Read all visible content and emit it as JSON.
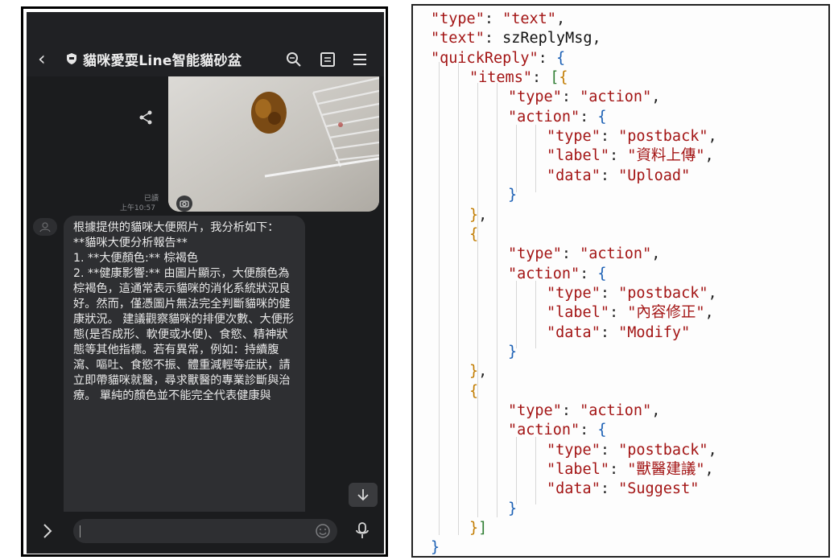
{
  "chat": {
    "title": "貓咪愛耍Line智能貓砂盆",
    "read_label": "已讀",
    "time": "上午10:57",
    "bot_message": [
      "根據提供的貓咪大便照片，我分析如下：",
      "",
      "**貓咪大便分析報告**",
      "",
      "1. **大便顏色:** 棕褐色",
      "",
      "2. **健康影響:** 由圖片顯示，大便顏色為棕褐色，這通常表示貓咪的消化系統狀況良好。然而，僅憑圖片無法完全判斷貓咪的健康狀況。 建議觀察貓咪的排便次數、大便形態(是否成形、軟便或水便)、食慾、精神狀態等其他指標。若有異常，例如：持續腹瀉、嘔吐、食慾不振、體重減輕等症狀，請立即帶貓咪就醫，尋求獸醫的專業診斷與治療。 單純的顏色並不能完全代表健康與"
    ],
    "input_placeholder": "",
    "icons": [
      "back-icon",
      "shield-icon",
      "search-icon",
      "notes-icon",
      "menu-icon",
      "share-icon",
      "camera-icon",
      "scroll-down-icon",
      "expand-icon",
      "emoji-icon",
      "mic-icon"
    ]
  },
  "code": {
    "lines": [
      {
        "indent": 0,
        "tokens": [
          [
            "s",
            "\"type\""
          ],
          [
            "p",
            ": "
          ],
          [
            "s",
            "\"text\""
          ],
          [
            "p",
            ","
          ]
        ]
      },
      {
        "indent": 0,
        "tokens": [
          [
            "s",
            "\"text\""
          ],
          [
            "p",
            ": "
          ],
          [
            "v",
            "szReplyMsg"
          ],
          [
            "p",
            ","
          ]
        ]
      },
      {
        "indent": 0,
        "tokens": [
          [
            "s",
            "\"quickReply\""
          ],
          [
            "p",
            ": "
          ],
          [
            "b1",
            "{"
          ]
        ]
      },
      {
        "indent": 1,
        "tokens": [
          [
            "s",
            "\"items\""
          ],
          [
            "p",
            ": "
          ],
          [
            "b2",
            "["
          ],
          [
            "b3",
            "{"
          ]
        ]
      },
      {
        "indent": 2,
        "tokens": [
          [
            "s",
            "\"type\""
          ],
          [
            "p",
            ": "
          ],
          [
            "s",
            "\"action\""
          ],
          [
            "p",
            ","
          ]
        ]
      },
      {
        "indent": 2,
        "tokens": [
          [
            "s",
            "\"action\""
          ],
          [
            "p",
            ": "
          ],
          [
            "b1",
            "{"
          ]
        ]
      },
      {
        "indent": 3,
        "tokens": [
          [
            "s",
            "\"type\""
          ],
          [
            "p",
            ": "
          ],
          [
            "s",
            "\"postback\""
          ],
          [
            "p",
            ","
          ]
        ]
      },
      {
        "indent": 3,
        "tokens": [
          [
            "s",
            "\"label\""
          ],
          [
            "p",
            ": "
          ],
          [
            "s",
            "\"資料上傳\""
          ],
          [
            "p",
            ","
          ]
        ]
      },
      {
        "indent": 3,
        "tokens": [
          [
            "s",
            "\"data\""
          ],
          [
            "p",
            ": "
          ],
          [
            "s",
            "\"Upload\""
          ]
        ]
      },
      {
        "indent": 2,
        "tokens": [
          [
            "b1",
            "}"
          ]
        ]
      },
      {
        "indent": 1,
        "tokens": [
          [
            "b3",
            "}"
          ],
          [
            "p",
            ","
          ]
        ]
      },
      {
        "indent": 1,
        "tokens": [
          [
            "b3",
            "{"
          ]
        ]
      },
      {
        "indent": 2,
        "tokens": [
          [
            "s",
            "\"type\""
          ],
          [
            "p",
            ": "
          ],
          [
            "s",
            "\"action\""
          ],
          [
            "p",
            ","
          ]
        ]
      },
      {
        "indent": 2,
        "tokens": [
          [
            "s",
            "\"action\""
          ],
          [
            "p",
            ": "
          ],
          [
            "b1",
            "{"
          ]
        ]
      },
      {
        "indent": 3,
        "tokens": [
          [
            "s",
            "\"type\""
          ],
          [
            "p",
            ": "
          ],
          [
            "s",
            "\"postback\""
          ],
          [
            "p",
            ","
          ]
        ]
      },
      {
        "indent": 3,
        "tokens": [
          [
            "s",
            "\"label\""
          ],
          [
            "p",
            ": "
          ],
          [
            "s",
            "\"內容修正\""
          ],
          [
            "p",
            ","
          ]
        ]
      },
      {
        "indent": 3,
        "tokens": [
          [
            "s",
            "\"data\""
          ],
          [
            "p",
            ": "
          ],
          [
            "s",
            "\"Modify\""
          ]
        ]
      },
      {
        "indent": 2,
        "tokens": [
          [
            "b1",
            "}"
          ]
        ]
      },
      {
        "indent": 1,
        "tokens": [
          [
            "b3",
            "}"
          ],
          [
            "p",
            ","
          ]
        ]
      },
      {
        "indent": 1,
        "tokens": [
          [
            "b3",
            "{"
          ]
        ]
      },
      {
        "indent": 2,
        "tokens": [
          [
            "s",
            "\"type\""
          ],
          [
            "p",
            ": "
          ],
          [
            "s",
            "\"action\""
          ],
          [
            "p",
            ","
          ]
        ]
      },
      {
        "indent": 2,
        "tokens": [
          [
            "s",
            "\"action\""
          ],
          [
            "p",
            ": "
          ],
          [
            "b1",
            "{"
          ]
        ]
      },
      {
        "indent": 3,
        "tokens": [
          [
            "s",
            "\"type\""
          ],
          [
            "p",
            ": "
          ],
          [
            "s",
            "\"postback\""
          ],
          [
            "p",
            ","
          ]
        ]
      },
      {
        "indent": 3,
        "tokens": [
          [
            "s",
            "\"label\""
          ],
          [
            "p",
            ": "
          ],
          [
            "s",
            "\"獸醫建議\""
          ],
          [
            "p",
            ","
          ]
        ]
      },
      {
        "indent": 3,
        "tokens": [
          [
            "s",
            "\"data\""
          ],
          [
            "p",
            ": "
          ],
          [
            "s",
            "\"Suggest\""
          ]
        ]
      },
      {
        "indent": 2,
        "tokens": [
          [
            "b1",
            "}"
          ]
        ]
      },
      {
        "indent": 1,
        "tokens": [
          [
            "b3",
            "}"
          ],
          [
            "b2",
            "]"
          ]
        ]
      },
      {
        "indent": 0,
        "tokens": [
          [
            "b1",
            "}"
          ]
        ]
      }
    ]
  }
}
